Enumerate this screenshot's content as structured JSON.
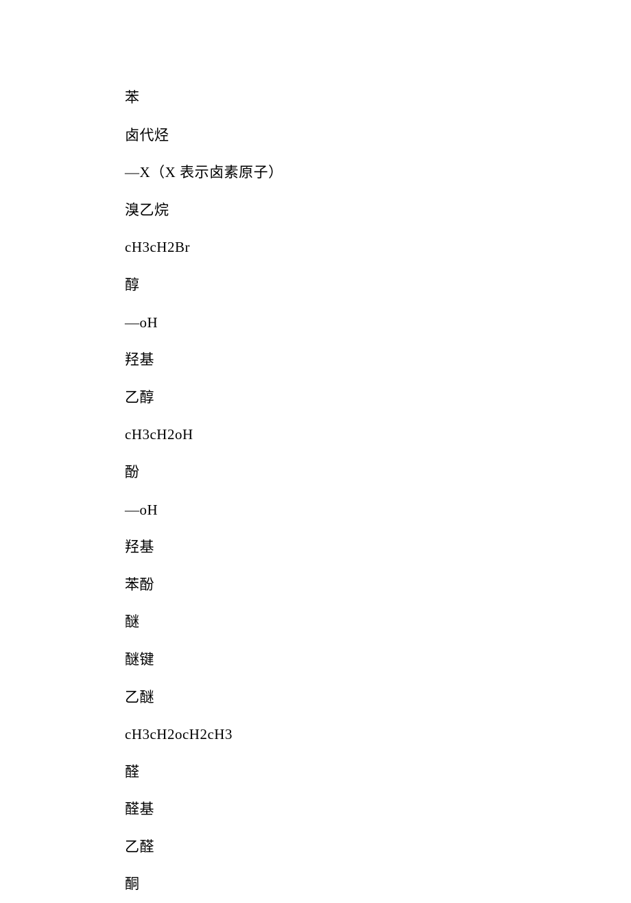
{
  "lines": [
    "苯",
    "卤代烃",
    "—X（X 表示卤素原子）",
    "溴乙烷",
    "cH3cH2Br",
    "醇",
    "—oH",
    "羟基",
    "乙醇",
    "cH3cH2oH",
    "酚",
    "—oH",
    "羟基",
    "苯酚",
    "醚",
    "醚键",
    "乙醚",
    "cH3cH2ocH2cH3",
    "醛",
    "醛基",
    "乙醛",
    "酮"
  ]
}
